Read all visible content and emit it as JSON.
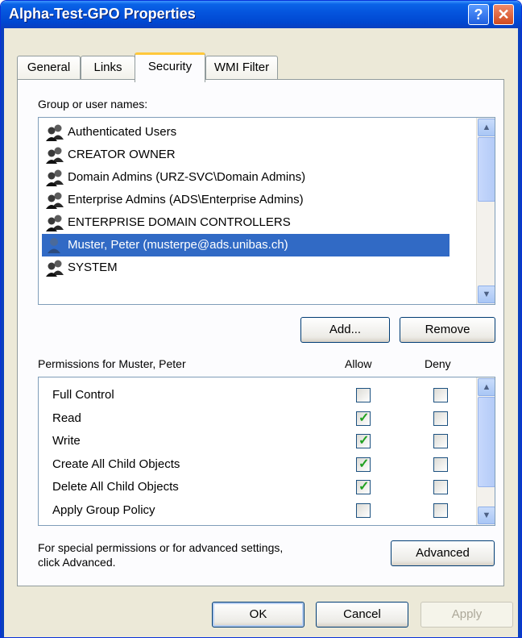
{
  "window": {
    "title": "Alpha-Test-GPO Properties",
    "help_label": "?",
    "close_label": "✕"
  },
  "tabs": [
    {
      "label": "General"
    },
    {
      "label": "Links"
    },
    {
      "label": "Security"
    },
    {
      "label": "WMI Filter"
    }
  ],
  "group_label": "Group or user names:",
  "users": [
    {
      "name": "Authenticated Users",
      "icon": "group-icon"
    },
    {
      "name": "CREATOR OWNER",
      "icon": "group-icon"
    },
    {
      "name": "Domain Admins (URZ-SVC\\Domain Admins)",
      "icon": "group-icon"
    },
    {
      "name": "Enterprise Admins (ADS\\Enterprise Admins)",
      "icon": "group-icon"
    },
    {
      "name": "ENTERPRISE DOMAIN CONTROLLERS",
      "icon": "group-icon"
    },
    {
      "name": "Muster, Peter (musterpe@ads.unibas.ch)",
      "icon": "user-icon",
      "selected": true
    },
    {
      "name": "SYSTEM",
      "icon": "group-icon"
    }
  ],
  "buttons": {
    "add": "Add...",
    "remove": "Remove",
    "advanced": "Advanced",
    "ok": "OK",
    "cancel": "Cancel",
    "apply": "Apply"
  },
  "permissions": {
    "label": "Permissions for Muster, Peter",
    "allow_header": "Allow",
    "deny_header": "Deny",
    "rows": [
      {
        "name": "Full Control",
        "allow": false,
        "deny": false
      },
      {
        "name": "Read",
        "allow": true,
        "deny": false
      },
      {
        "name": "Write",
        "allow": true,
        "deny": false
      },
      {
        "name": "Create All Child Objects",
        "allow": true,
        "deny": false
      },
      {
        "name": "Delete All Child Objects",
        "allow": true,
        "deny": false
      },
      {
        "name": "Apply Group Policy",
        "allow": false,
        "deny": false
      }
    ]
  },
  "special_text_line1": "For special permissions or for advanced settings,",
  "special_text_line2": "click Advanced.",
  "colors": {
    "selection": "#316ac5",
    "titlebar": "#0453dc",
    "check": "#21a121"
  }
}
